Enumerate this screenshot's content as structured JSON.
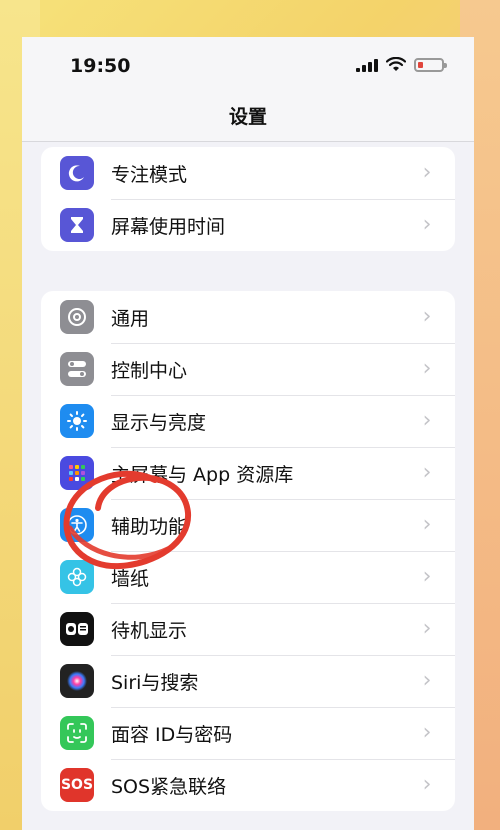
{
  "status": {
    "time": "19:50"
  },
  "nav": {
    "title": "设置"
  },
  "groups": [
    {
      "items": [
        {
          "label": "专注模式",
          "icon": "moon-icon",
          "color": "#5856d6"
        },
        {
          "label": "屏幕使用时间",
          "icon": "hourglass-icon",
          "color": "#5856d6"
        }
      ]
    },
    {
      "items": [
        {
          "label": "通用",
          "icon": "gear-icon",
          "color": "#8e8e93"
        },
        {
          "label": "控制中心",
          "icon": "toggles-icon",
          "color": "#8e8e93"
        },
        {
          "label": "显示与亮度",
          "icon": "sun-icon",
          "color": "#1e8cf0"
        },
        {
          "label": "主屏幕与 App 资源库",
          "icon": "grid-icon",
          "color": "#4a4ae0"
        },
        {
          "label": "辅助功能",
          "icon": "accessibility-icon",
          "color": "#1e8cf0"
        },
        {
          "label": "墙纸",
          "icon": "flower-icon",
          "color": "#35c3e6"
        },
        {
          "label": "待机显示",
          "icon": "standby-icon",
          "color": "#111111"
        },
        {
          "label": "Siri与搜索",
          "icon": "siri-icon",
          "color": "#222222"
        },
        {
          "label": "面容 ID与密码",
          "icon": "face-id-icon",
          "color": "#34c759"
        },
        {
          "label": "SOS紧急联络",
          "icon": "sos-icon",
          "color": "#e0352b",
          "text": "SOS"
        }
      ]
    }
  ],
  "annotation": {
    "color": "#e33b2e"
  }
}
